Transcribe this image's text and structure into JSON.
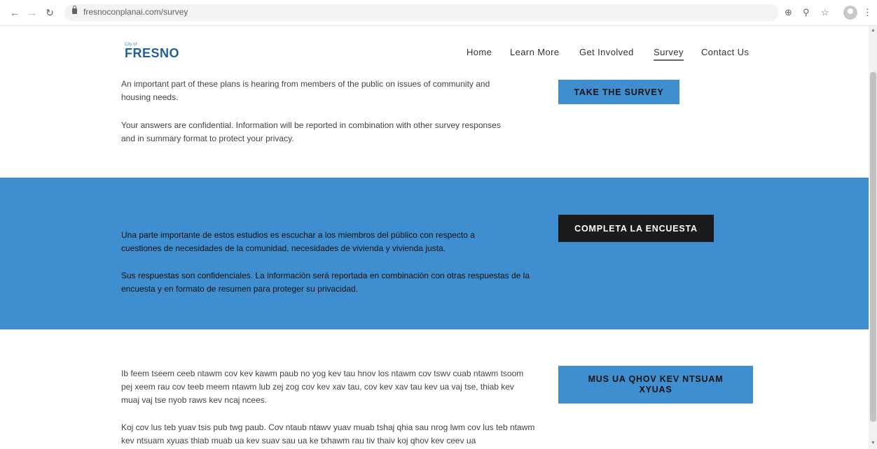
{
  "browser": {
    "url": "fresnoconplanai.com/survey",
    "back_icon": "arrow-left-icon",
    "forward_icon": "arrow-right-icon",
    "reload_icon": "reload-icon"
  },
  "header": {
    "logo_small": "City of",
    "logo_big": "FRESNO",
    "menu": {
      "home": "Home",
      "learn_more": "Learn More",
      "get_involved": "Get Involved",
      "survey": "Survey",
      "contact_us": "Contact Us"
    }
  },
  "english": {
    "para1": "An important part of these plans is hearing from members of the public on issues of community and housing needs.",
    "para2": "Your answers  are confidential. Information will be reported in combination with other survey responses and in summary format to protect your privacy.",
    "button": "TAKE THE SURVEY"
  },
  "spanish": {
    "para1": "Una parte importante de estos estudios es escuchar a los miembros del público con respecto a cuestiones de necesidades de la comunidad, necesidades de vivienda y vivienda justa.",
    "para2": "Sus respuestas son confidenciales. La información será reportada en combinación con otras respuestas de la encuesta y en formato de resumen para proteger su privacidad.",
    "button": "COMPLETA LA ENCUESTA"
  },
  "hmong": {
    "para1": "Ib feem tseem ceeb ntawm cov kev kawm paub no yog kev tau hnov los ntawm cov tswv cuab ntawm tsoom pej xeem rau cov teeb meem ntawm lub zej zog cov kev xav tau, cov kev xav tau kev ua vaj tse, thiab kev muaj vaj tse nyob raws kev ncaj ncees.",
    "para2": "Koj cov lus teb yuav tsis pub twg paub. Cov ntaub ntawv yuav muab tshaj qhia sau nrog lwm cov lus teb ntawm kev ntsuam xyuas thiab muab ua kev suav sau ua ke txhawm rau tiv thaiv koj qhov kev ceev ua",
    "button": "MUS UA QHOV KEV NTSUAM XYUAS"
  },
  "colors": {
    "band": "#3f8fd0",
    "dark_button": "#1b1b1b",
    "logo": "#1f5f9e"
  }
}
